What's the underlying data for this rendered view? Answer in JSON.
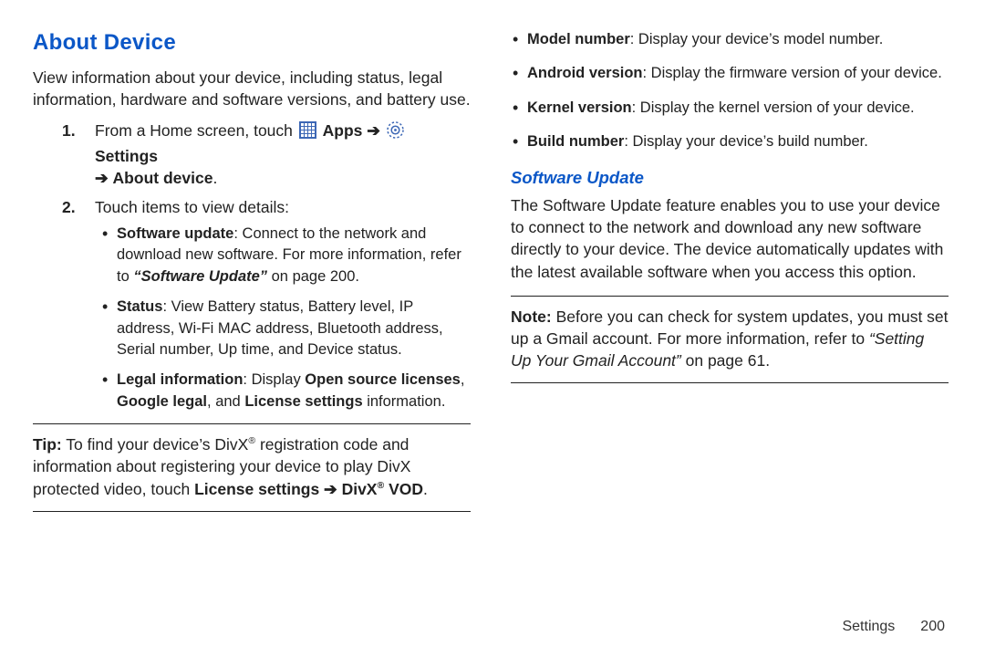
{
  "left": {
    "heading": "About Device",
    "intro": "View information about your device, including status, legal information, hardware and software versions, and battery use.",
    "steps": {
      "s1": {
        "num": "1.",
        "pre": "From a Home screen, touch ",
        "apps": "Apps",
        "arrow1": "➔",
        "settings": "Settings",
        "arrow2": "➔",
        "about": "About device"
      },
      "s2": {
        "num": "2.",
        "lead": "Touch items to view details:",
        "b1_label": "Software update",
        "b1_a": ": Connect to the network and download new software. For more information, refer to ",
        "b1_ref": "“Software Update”",
        "b1_b": " on page 200.",
        "b2_label": "Status",
        "b2_body": ": View Battery status, Battery level, IP address, Wi-Fi MAC address, Bluetooth address, Serial number, Up time, and Device status.",
        "b3_label": "Legal information",
        "b3_a": ": Display ",
        "b3_osl": "Open source licenses",
        "b3_comma": ", ",
        "b3_gl": "Google legal",
        "b3_and": ", and ",
        "b3_ls": "License settings",
        "b3_end": " information."
      }
    },
    "tip": {
      "label": "Tip:",
      "a": " To find your device’s DivX",
      "reg1": "®",
      "b": " registration code and information about registering your device to play DivX protected video, touch ",
      "c": "License settings ➔ DivX",
      "reg2": "®",
      "d": " VOD",
      "e": "."
    }
  },
  "right": {
    "b1_label": "Model number",
    "b1_body": ": Display your device’s model number.",
    "b2_label": "Android version",
    "b2_body": ": Display the firmware version of your device.",
    "b3_label": "Kernel version",
    "b3_body": ": Display the kernel version of your device.",
    "b4_label": "Build number",
    "b4_body": ": Display your device’s build number.",
    "sub": "Software Update",
    "p": "The Software Update feature enables you to use your device to connect to the network and download any new software directly to your device. The device automatically updates with the latest available software when you access this option.",
    "note": {
      "label": "Note:",
      "a": " Before you can check for system updates, you must set up a Gmail account. For more information, refer to ",
      "ref": "“Setting Up Your Gmail Account”",
      "b": "  on page 61."
    }
  },
  "footer": {
    "section": "Settings",
    "page": "200"
  }
}
